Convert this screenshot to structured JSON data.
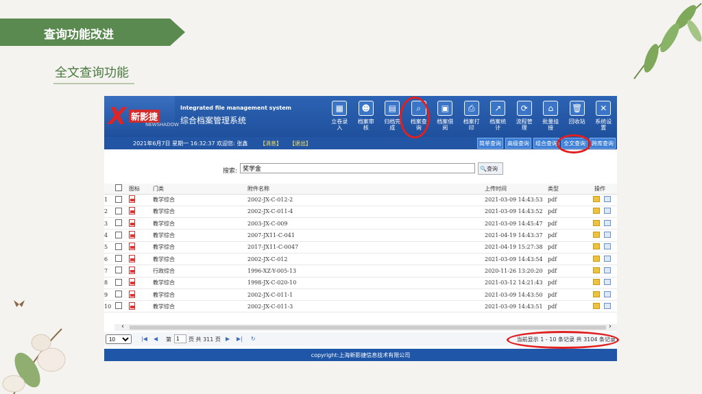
{
  "slide": {
    "banner_title": "查询功能改进",
    "subtitle": "全文查询功能"
  },
  "app": {
    "logo_text": "新影捷",
    "logo_sub": "NEWSHADOW",
    "system_name_en": "Integrated file management system",
    "system_name_cn": "综合档案管理系统",
    "toolbar": [
      {
        "label": "立卷录入",
        "icon": "archive-entry-icon"
      },
      {
        "label": "档案审核",
        "icon": "user-review-icon"
      },
      {
        "label": "归档完成",
        "icon": "archive-done-icon"
      },
      {
        "label": "档案查询",
        "icon": "archive-search-icon"
      },
      {
        "label": "档案借阅",
        "icon": "archive-borrow-icon"
      },
      {
        "label": "档案打印",
        "icon": "printer-icon"
      },
      {
        "label": "档案统计",
        "icon": "chart-icon"
      },
      {
        "label": "流程管理",
        "icon": "workflow-icon"
      },
      {
        "label": "批量挂接",
        "icon": "home-link-icon"
      },
      {
        "label": "回收站",
        "icon": "trash-icon"
      },
      {
        "label": "系统设置",
        "icon": "settings-icon"
      }
    ],
    "info": {
      "datetime_user": "2021年6月7日 星期一  16:32:37 欢迎您: 张鑫",
      "message": "【消息】",
      "logout": "【退出】"
    },
    "query_tabs": [
      "简单查询",
      "高级查询",
      "组合查询",
      "全文查询",
      "跨库查询"
    ],
    "search": {
      "label": "搜索:",
      "value": "奖学金",
      "button": "查询"
    },
    "table": {
      "headers": [
        "图标",
        "门类",
        "附件名称",
        "上传时间",
        "类型",
        "操作"
      ],
      "rows": [
        {
          "n": "1",
          "cat": "教学综合",
          "name": "2002-JX-C-012-2",
          "time": "2021-03-09 14:43:53",
          "type": "pdf"
        },
        {
          "n": "2",
          "cat": "教学综合",
          "name": "2002-JX-C-011-4",
          "time": "2021-03-09 14:43:52",
          "type": "pdf"
        },
        {
          "n": "3",
          "cat": "教学综合",
          "name": "2003-JX-C-009",
          "time": "2021-03-09 14:45:47",
          "type": "pdf"
        },
        {
          "n": "4",
          "cat": "教学综合",
          "name": "2007-JX11-C-041",
          "time": "2021-04-19 14:43:37",
          "type": "pdf"
        },
        {
          "n": "5",
          "cat": "教学综合",
          "name": "2017-JX11-C-0047",
          "time": "2021-04-19 15:27:38",
          "type": "pdf"
        },
        {
          "n": "6",
          "cat": "教学综合",
          "name": "2002-JX-C-012",
          "time": "2021-03-09 14:43:54",
          "type": "pdf"
        },
        {
          "n": "7",
          "cat": "行政综合",
          "name": "1996-XZ-Y-005-13",
          "time": "2020-11-26 13:20:20",
          "type": "pdf"
        },
        {
          "n": "8",
          "cat": "教学综合",
          "name": "1998-JX-C-020-10",
          "time": "2021-03-12 14:21:43",
          "type": "pdf"
        },
        {
          "n": "9",
          "cat": "教学综合",
          "name": "2002-JX-C-011-1",
          "time": "2021-03-09 14:43:50",
          "type": "pdf"
        },
        {
          "n": "10",
          "cat": "教学综合",
          "name": "2002-JX-C-011-3",
          "time": "2021-03-09 14:43:51",
          "type": "pdf"
        }
      ]
    },
    "pager": {
      "page_size": "10",
      "page_prefix": "第",
      "page_value": "1",
      "page_suffix": "页 共 311 页",
      "summary": "当前显示 1 - 10 条记录 共 3104 条记录"
    },
    "footer": "copyright:上海新影捷信息技术有限公司"
  },
  "colors": {
    "banner": "#5a8a50",
    "header_blue": "#1a4a95",
    "highlight_ring": "#e02020"
  }
}
